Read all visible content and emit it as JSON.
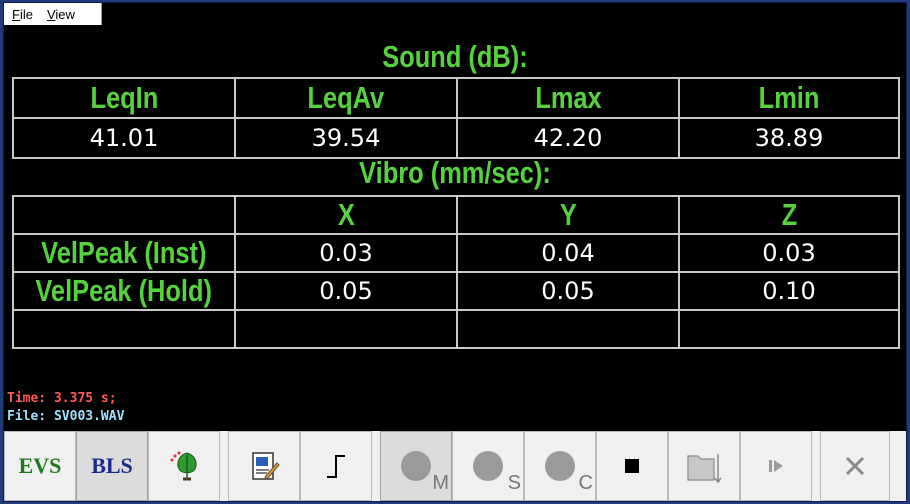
{
  "menu": {
    "file_label": "File",
    "view_label": "View"
  },
  "sound": {
    "title": "Sound (dB):",
    "headers": [
      "LeqIn",
      "LeqAv",
      "Lmax",
      "Lmin"
    ],
    "values": [
      "41.01",
      "39.54",
      "42.20",
      "38.89"
    ]
  },
  "vibro": {
    "title": "Vibro (mm/sec):",
    "axis_headers": [
      "X",
      "Y",
      "Z"
    ],
    "rows": [
      {
        "label": "VelPeak (Inst)",
        "values": [
          "0.03",
          "0.04",
          "0.03"
        ]
      },
      {
        "label": "VelPeak (Hold)",
        "values": [
          "0.05",
          "0.05",
          "0.10"
        ]
      }
    ]
  },
  "status": {
    "time": "Time: 3.375 s;",
    "file": "File:  SV003.WAV"
  },
  "toolbar": {
    "evs_label": "EVS",
    "bls_label": "BLS",
    "m_label": "M",
    "s_label": "S",
    "c_label": "C",
    "icons": [
      "tree-icon",
      "report-icon",
      "step-icon",
      "record-m-icon",
      "record-s-icon",
      "record-c-icon",
      "stop-icon",
      "folder-export-icon",
      "play-step-icon",
      "close-icon"
    ]
  },
  "colors": {
    "green_text": "#55d23e",
    "time_text": "#ff5a5a",
    "file_text": "#9fe0ff",
    "evs_color": "#1f7a1f",
    "bls_color": "#1a2b8a"
  }
}
